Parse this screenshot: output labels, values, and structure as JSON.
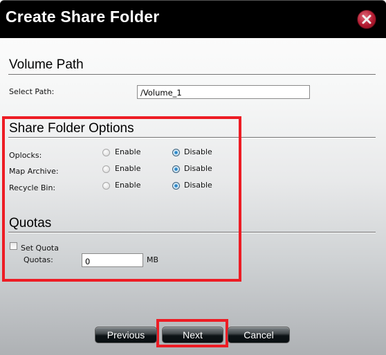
{
  "dialog": {
    "title": "Create Share Folder",
    "close_icon": "close-x-circle-icon"
  },
  "volume_path": {
    "heading": "Volume Path",
    "select_path_label": "Select Path:",
    "select_path_value": "/Volume_1"
  },
  "share_folder_options": {
    "heading": "Share Folder Options",
    "rows": [
      {
        "label": "Oplocks:",
        "enable_label": "Enable",
        "disable_label": "Disable",
        "selected": "Disable"
      },
      {
        "label": "Map Archive:",
        "enable_label": "Enable",
        "disable_label": "Disable",
        "selected": "Disable"
      },
      {
        "label": "Recycle Bin:",
        "enable_label": "Enable",
        "disable_label": "Disable",
        "selected": "Disable"
      }
    ]
  },
  "quotas": {
    "heading": "Quotas",
    "set_quota_label": "Set Quota",
    "set_quota_checked": false,
    "quotas_label": "Quotas:",
    "quotas_value": "0",
    "unit": "MB"
  },
  "buttons": {
    "previous": "Previous",
    "next": "Next",
    "cancel": "Cancel"
  },
  "annotation_color": "#ed1c24"
}
